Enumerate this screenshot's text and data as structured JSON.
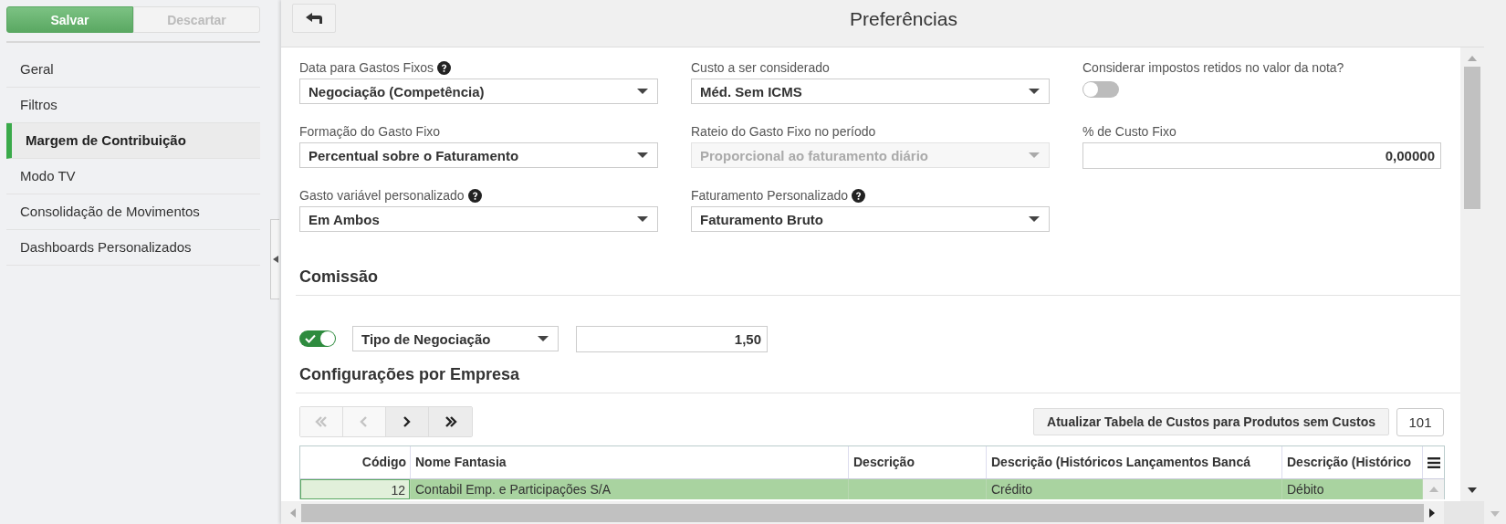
{
  "sidebar": {
    "buttons": [
      {
        "label": "Salvar",
        "kind": "primary",
        "disabled": false
      },
      {
        "label": "Descartar",
        "kind": "secondary",
        "disabled": true
      }
    ],
    "items": [
      {
        "label": "Geral",
        "selected": false
      },
      {
        "label": "Filtros",
        "selected": false
      },
      {
        "label": "Margem de Contribuição",
        "selected": true
      },
      {
        "label": "Modo TV",
        "selected": false
      },
      {
        "label": "Consolidação de Movimentos",
        "selected": false
      },
      {
        "label": "Dashboards Personalizados",
        "selected": false
      }
    ]
  },
  "header": {
    "title": "Preferências"
  },
  "fields": [
    {
      "kind": "select",
      "label": "Data para Gastos Fixos",
      "help": true,
      "value": "Negociação (Competência)",
      "disabled": false
    },
    {
      "kind": "select",
      "label": "Custo a ser considerado",
      "help": false,
      "value": "Méd. Sem ICMS",
      "disabled": false
    },
    {
      "kind": "toggle",
      "label": "Considerar impostos retidos no valor da nota?",
      "help": false,
      "on": false
    },
    {
      "kind": "select",
      "label": "Formação do Gasto Fixo",
      "help": false,
      "value": "Percentual sobre o Faturamento",
      "disabled": false
    },
    {
      "kind": "select",
      "label": "Rateio do Gasto Fixo no período",
      "help": false,
      "value": "Proporcional ao faturamento diário",
      "disabled": true
    },
    {
      "kind": "number",
      "label": "% de Custo Fixo",
      "help": false,
      "value": "0,00000"
    },
    {
      "kind": "select",
      "label": "Gasto variável personalizado",
      "help": true,
      "value": "Em Ambos",
      "disabled": false
    },
    {
      "kind": "select",
      "label": "Faturamento Personalizado",
      "help": true,
      "value": "Faturamento Bruto",
      "disabled": false
    }
  ],
  "commission": {
    "title": "Comissão",
    "enabled": true,
    "type": "Tipo de Negociação",
    "value": "1,50"
  },
  "companies": {
    "title": "Configurações por Empresa",
    "pager": [
      {
        "kind": "first",
        "disabled": true
      },
      {
        "kind": "prev",
        "disabled": true
      },
      {
        "kind": "next",
        "disabled": false
      },
      {
        "kind": "last",
        "disabled": false
      }
    ],
    "update_button": "Atualizar Tabela de Custos para Produtos sem Custos",
    "page_size": "101",
    "table": {
      "columns": [
        "Código",
        "Nome Fantasia",
        "Descrição",
        "Descrição (Históricos Lançamentos Bancá",
        "Descrição (Histórico"
      ],
      "rows": [
        {
          "selected": true,
          "cells": [
            "12",
            "Contabil Emp. e Participações S/A",
            null,
            "Crédito",
            "Débito"
          ]
        }
      ]
    }
  }
}
